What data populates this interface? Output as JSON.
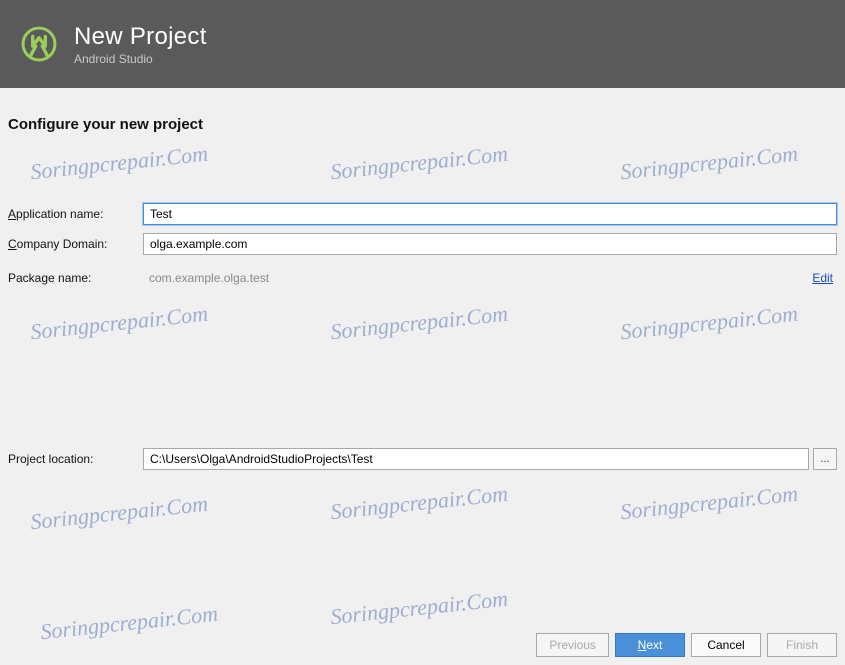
{
  "header": {
    "title": "New Project",
    "subtitle": "Android Studio"
  },
  "section": {
    "title": "Configure your new project"
  },
  "form": {
    "app_name_label": "Application name:",
    "app_name_value": "Test",
    "company_label": "Company Domain:",
    "company_value": "olga.example.com",
    "package_label": "Package name:",
    "package_value": "com.example.olga.test",
    "edit_label": "Edit",
    "location_label": "Project location:",
    "location_value": "C:\\Users\\Olga\\AndroidStudioProjects\\Test",
    "browse_label": "..."
  },
  "buttons": {
    "previous": "Previous",
    "next": "Next",
    "cancel": "Cancel",
    "finish": "Finish"
  },
  "watermark": "Soringpcrepair.Com"
}
